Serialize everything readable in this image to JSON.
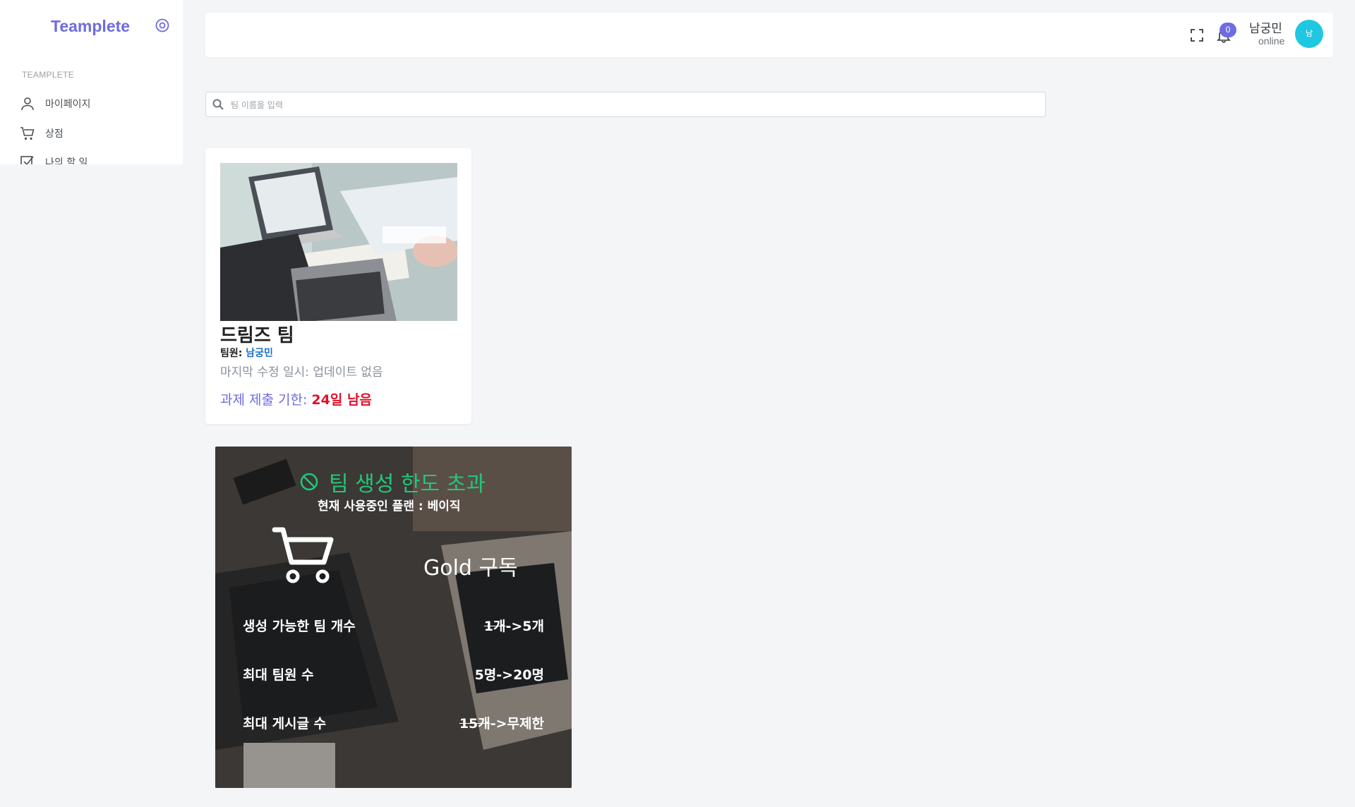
{
  "app": {
    "logo_text": "Teamplete"
  },
  "sidebar": {
    "heading": "TEAMPLETE",
    "items": [
      {
        "label": "마이페이지",
        "icon": "user-icon"
      },
      {
        "label": "상점",
        "icon": "cart-icon"
      },
      {
        "label": "나의 할 일",
        "icon": "checkbox-icon"
      }
    ]
  },
  "header": {
    "notification_count": "0",
    "user_name": "남궁민",
    "user_status": "online",
    "avatar_text": "남"
  },
  "search": {
    "placeholder": "팀 이름을 입력",
    "value": ""
  },
  "team_card": {
    "title": "드림즈 팀",
    "members_label": "팀원:",
    "members": "남궁민",
    "last_updated": "마지막 수정 일시: 업데이트 없음",
    "deadline_label": "과제 제출 기한:",
    "deadline_value": "24일 남음"
  },
  "limit_card": {
    "title": "팀 생성 한도 초과",
    "current_plan": "현재 사용중인 플랜 : 베이직",
    "upgrade_title": "Gold 구독",
    "rows": [
      {
        "label": "생성 가능한 팀 개수",
        "old": "1개",
        "arrow": "->",
        "new": "5개"
      },
      {
        "label": "최대 팀원 수",
        "old": "5명",
        "arrow": "->",
        "new": "20명"
      },
      {
        "label": "최대 게시글 수",
        "old": "15개",
        "arrow": "->",
        "new": "무제한"
      }
    ]
  },
  "colors": {
    "accent": "#6f6be0",
    "danger": "#e0102a",
    "success": "#22c77a",
    "avatar": "#1fc8e0"
  }
}
